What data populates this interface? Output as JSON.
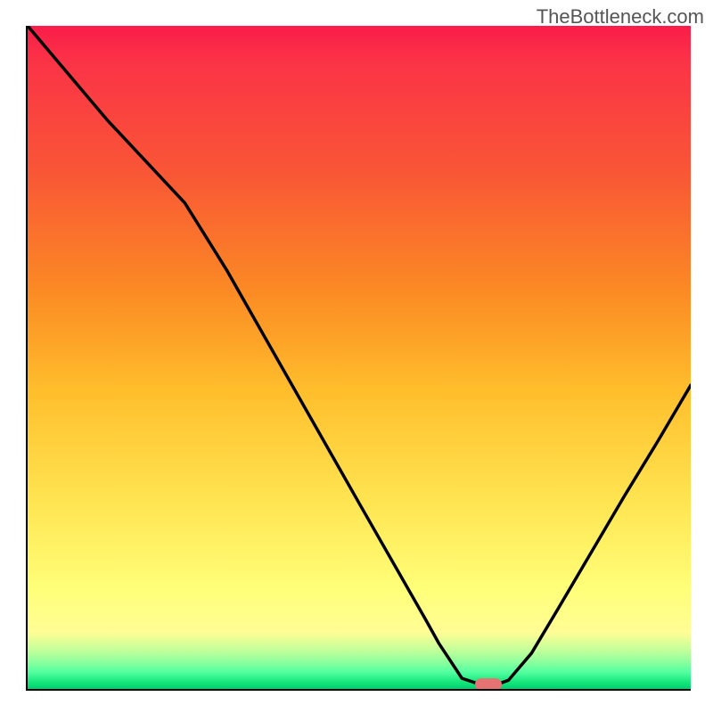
{
  "watermark": "TheBottleneck.com",
  "chart_data": {
    "type": "line",
    "title": "",
    "xlabel": "",
    "ylabel": "",
    "x_range": [
      0,
      100
    ],
    "y_range": [
      0,
      100
    ],
    "series": [
      {
        "name": "curve",
        "points": [
          {
            "x": 0,
            "y": 100
          },
          {
            "x": 12,
            "y": 85.8
          },
          {
            "x": 23.7,
            "y": 73.3
          },
          {
            "x": 30,
            "y": 63.2
          },
          {
            "x": 40,
            "y": 45.6
          },
          {
            "x": 50,
            "y": 28.0
          },
          {
            "x": 60,
            "y": 10.5
          },
          {
            "x": 62,
            "y": 6.9
          },
          {
            "x": 65.5,
            "y": 1.6
          },
          {
            "x": 68.2,
            "y": 0.7
          },
          {
            "x": 70.8,
            "y": 0.7
          },
          {
            "x": 72.5,
            "y": 1.3
          },
          {
            "x": 76,
            "y": 5.4
          },
          {
            "x": 80,
            "y": 12.1
          },
          {
            "x": 85,
            "y": 20.6
          },
          {
            "x": 90,
            "y": 29.1
          },
          {
            "x": 95,
            "y": 37.3
          },
          {
            "x": 100,
            "y": 45.8
          }
        ]
      }
    ],
    "marker": {
      "x": 69.5,
      "y": 0.7
    }
  }
}
